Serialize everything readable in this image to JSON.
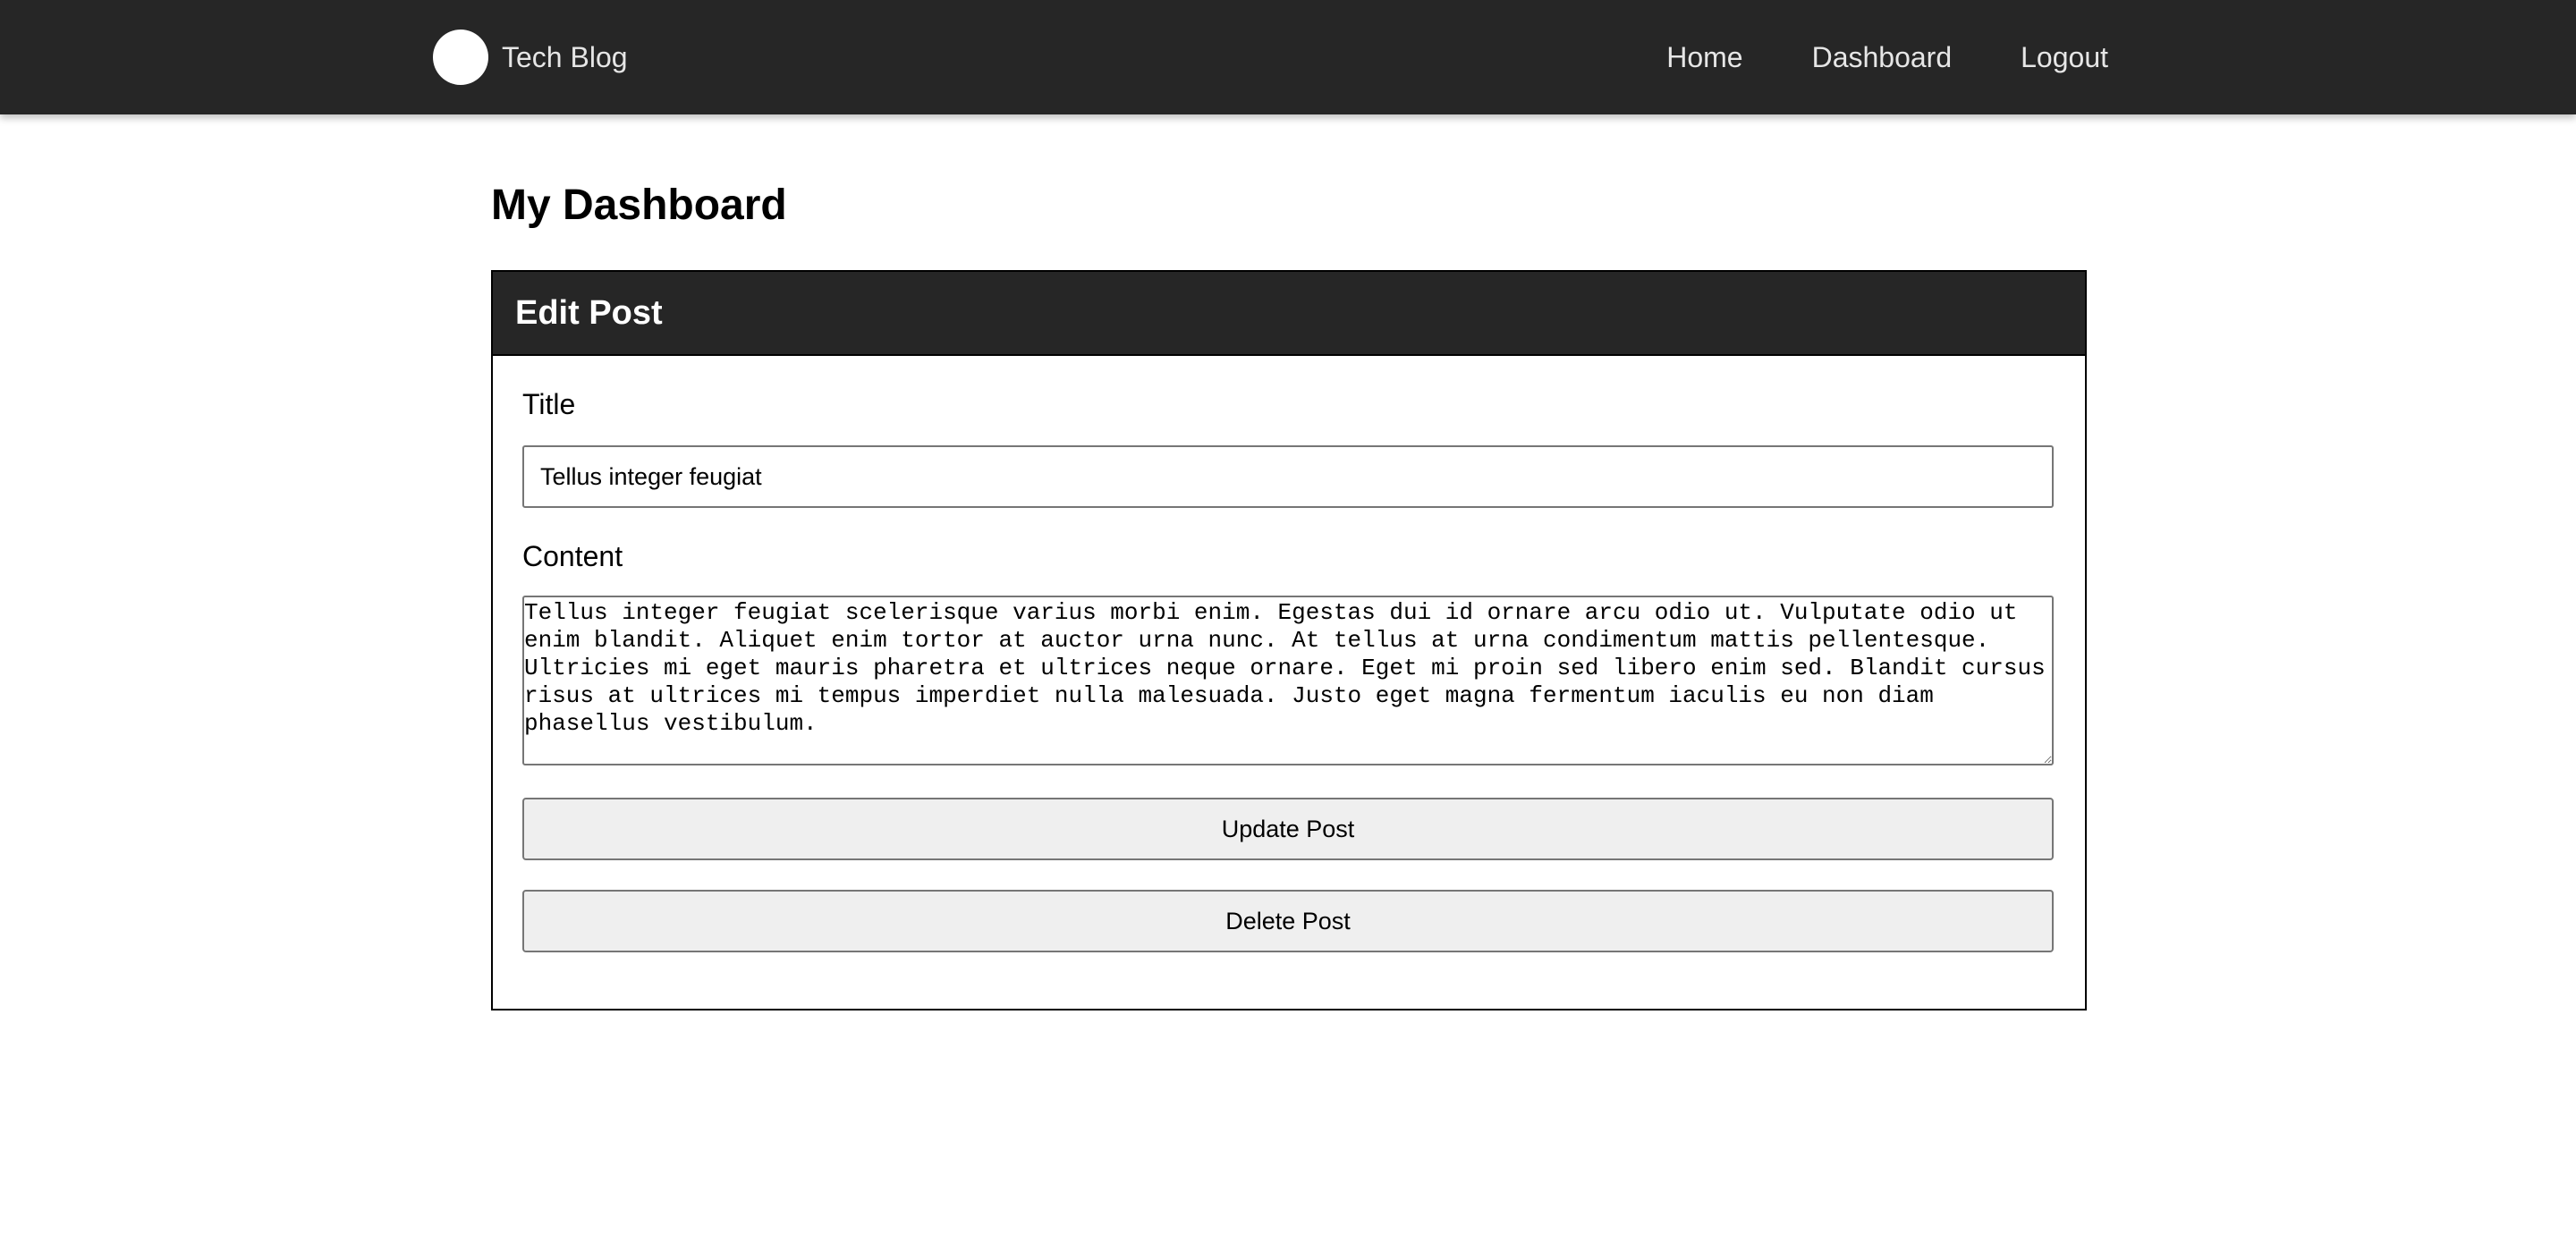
{
  "navbar": {
    "brand": "Tech Blog",
    "links": [
      "Home",
      "Dashboard",
      "Logout"
    ]
  },
  "main": {
    "title": "My Dashboard",
    "card": {
      "header": "Edit Post",
      "title_label": "Title",
      "title_value": "Tellus integer feugiat",
      "content_label": "Content",
      "content_value": "Tellus integer feugiat scelerisque varius morbi enim. Egestas dui id ornare arcu odio ut. Vulputate odio ut enim blandit. Aliquet enim tortor at auctor urna nunc. At tellus at urna condimentum mattis pellentesque. Ultricies mi eget mauris pharetra et ultrices neque ornare. Eget mi proin sed libero enim sed. Blandit cursus risus at ultrices mi tempus imperdiet nulla malesuada. Justo eget magna fermentum iaculis eu non diam phasellus vestibulum.",
      "update_button": "Update Post",
      "delete_button": "Delete Post"
    }
  },
  "colors": {
    "navbar_bg": "#262626",
    "nav_text": "#e6e6e6",
    "button_bg": "#efefef"
  }
}
